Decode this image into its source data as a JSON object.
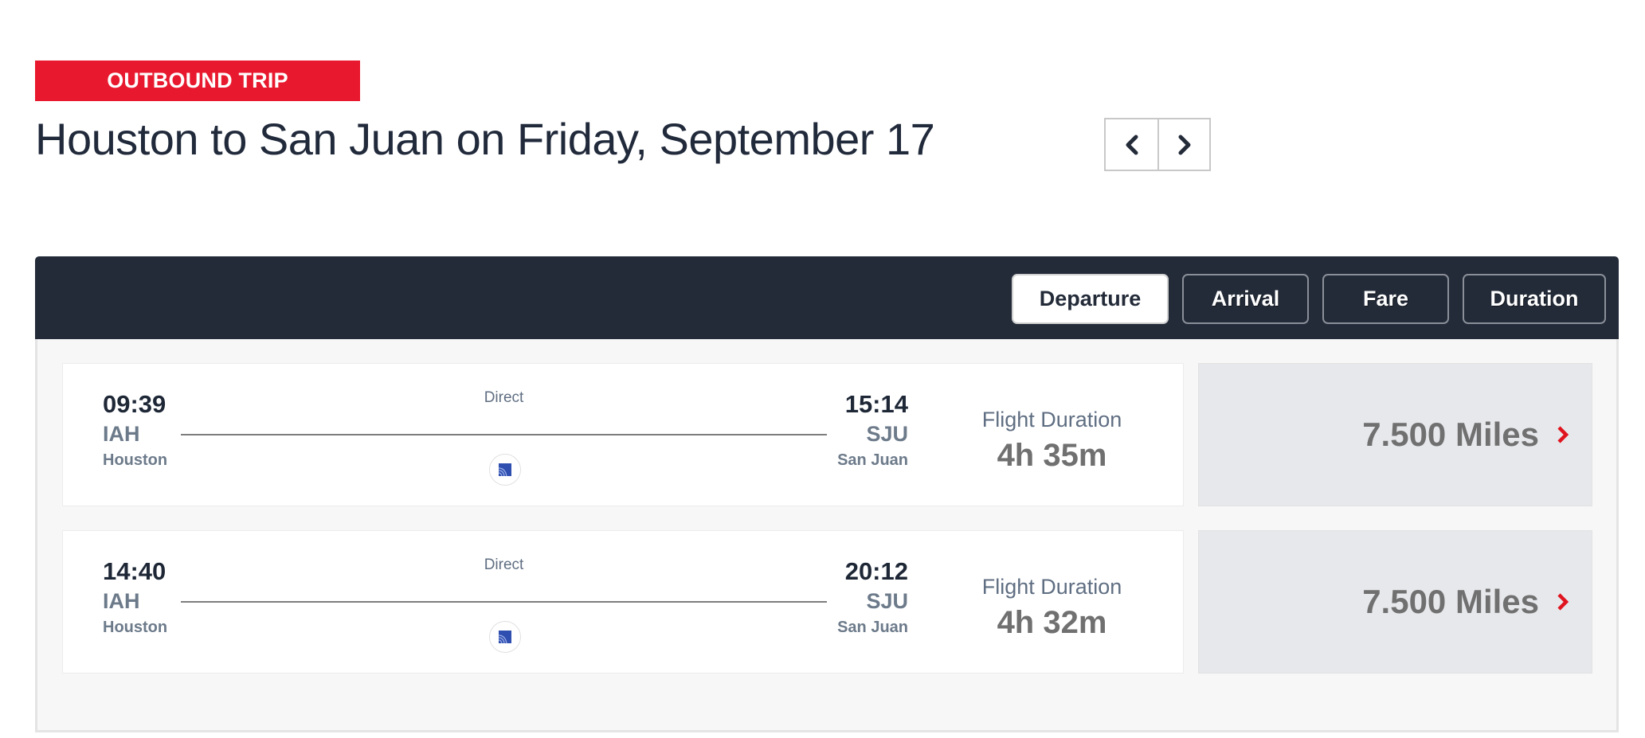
{
  "header": {
    "trip_label": "OUTBOUND TRIP",
    "title": "Houston to San Juan on Friday, September 17",
    "nav": {
      "prev_icon": "chevron-left-icon",
      "next_icon": "chevron-right-icon"
    }
  },
  "sort": {
    "options": [
      {
        "label": "Departure",
        "active": true
      },
      {
        "label": "Arrival",
        "active": false
      },
      {
        "label": "Fare",
        "active": false
      },
      {
        "label": "Duration",
        "active": false
      }
    ]
  },
  "flights": [
    {
      "departure": {
        "time": "09:39",
        "code": "IAH",
        "city": "Houston"
      },
      "arrival": {
        "time": "15:14",
        "code": "SJU",
        "city": "San Juan"
      },
      "stops": "Direct",
      "airline_icon": "airline-logo-icon",
      "duration_label": "Flight Duration",
      "duration": "4h 35m",
      "fare": "7.500 Miles",
      "fare_icon": "chevron-right-icon"
    },
    {
      "departure": {
        "time": "14:40",
        "code": "IAH",
        "city": "Houston"
      },
      "arrival": {
        "time": "20:12",
        "code": "SJU",
        "city": "San Juan"
      },
      "stops": "Direct",
      "airline_icon": "airline-logo-icon",
      "duration_label": "Flight Duration",
      "duration": "4h 32m",
      "fare": "7.500 Miles",
      "fare_icon": "chevron-right-icon"
    }
  ],
  "colors": {
    "accent_red": "#e8192f",
    "navy": "#232b39",
    "fare_bg": "#e7e8ec"
  }
}
